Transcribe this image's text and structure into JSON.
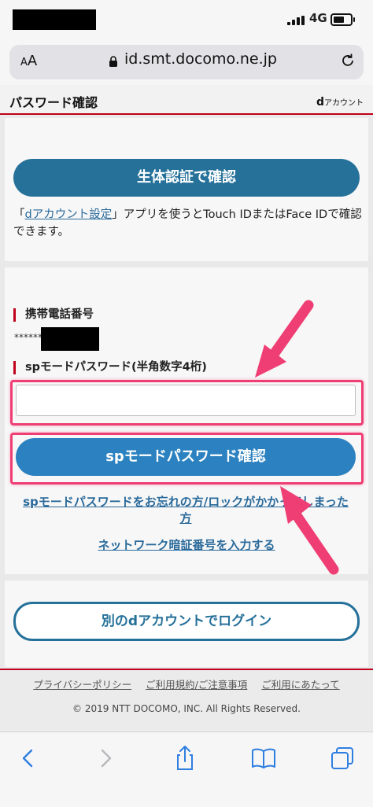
{
  "status": {
    "network": "4G"
  },
  "browser": {
    "text_size_label": "AA",
    "url": "id.smt.docomo.ne.jp"
  },
  "header": {
    "title": "パスワード確認",
    "brand_d": "d",
    "brand_rest": "アカウント"
  },
  "biometric": {
    "button_label": "生体認証で確認",
    "note_open": "「",
    "note_link": "dアカウント設定",
    "note_close": "」アプリを使うとTouch IDまたはFace IDで確認できます。"
  },
  "form": {
    "phone_label": "携帯電話番号",
    "phone_value": "******",
    "password_label": "spモードパスワード(半角数字4桁)",
    "password_value": "",
    "submit_label": "spモードパスワード確認",
    "forgot_link": "spモードパスワードをお忘れの方/ロックがかかってしまった方",
    "network_link": "ネットワーク暗証番号を入力する"
  },
  "other_account": {
    "button_label": "別のdアカウントでログイン"
  },
  "footer": {
    "links": [
      "プライバシーポリシー",
      "ご利用規約/ご注意事項",
      "ご利用にあたって"
    ],
    "copyright": "© 2019 NTT DOCOMO, INC. All Rights Reserved."
  },
  "toolbar": {
    "icons": [
      "back-icon",
      "forward-icon",
      "share-icon",
      "bookmarks-icon",
      "tabs-icon"
    ]
  },
  "colors": {
    "accent_red": "#c0001a",
    "button_blue": "#26719a",
    "highlight_pink": "#ef3e73"
  }
}
